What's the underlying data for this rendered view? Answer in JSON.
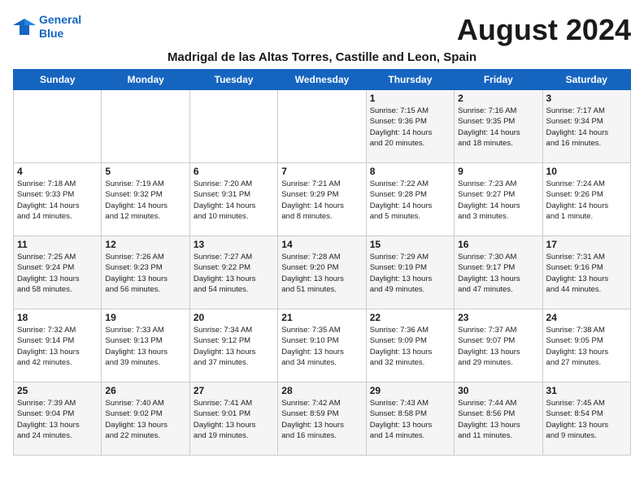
{
  "logo": {
    "line1": "General",
    "line2": "Blue"
  },
  "title": "August 2024",
  "subtitle": "Madrigal de las Altas Torres, Castille and Leon, Spain",
  "days_of_week": [
    "Sunday",
    "Monday",
    "Tuesday",
    "Wednesday",
    "Thursday",
    "Friday",
    "Saturday"
  ],
  "weeks": [
    [
      {
        "day": "",
        "info": ""
      },
      {
        "day": "",
        "info": ""
      },
      {
        "day": "",
        "info": ""
      },
      {
        "day": "",
        "info": ""
      },
      {
        "day": "1",
        "info": "Sunrise: 7:15 AM\nSunset: 9:36 PM\nDaylight: 14 hours\nand 20 minutes."
      },
      {
        "day": "2",
        "info": "Sunrise: 7:16 AM\nSunset: 9:35 PM\nDaylight: 14 hours\nand 18 minutes."
      },
      {
        "day": "3",
        "info": "Sunrise: 7:17 AM\nSunset: 9:34 PM\nDaylight: 14 hours\nand 16 minutes."
      }
    ],
    [
      {
        "day": "4",
        "info": "Sunrise: 7:18 AM\nSunset: 9:33 PM\nDaylight: 14 hours\nand 14 minutes."
      },
      {
        "day": "5",
        "info": "Sunrise: 7:19 AM\nSunset: 9:32 PM\nDaylight: 14 hours\nand 12 minutes."
      },
      {
        "day": "6",
        "info": "Sunrise: 7:20 AM\nSunset: 9:31 PM\nDaylight: 14 hours\nand 10 minutes."
      },
      {
        "day": "7",
        "info": "Sunrise: 7:21 AM\nSunset: 9:29 PM\nDaylight: 14 hours\nand 8 minutes."
      },
      {
        "day": "8",
        "info": "Sunrise: 7:22 AM\nSunset: 9:28 PM\nDaylight: 14 hours\nand 5 minutes."
      },
      {
        "day": "9",
        "info": "Sunrise: 7:23 AM\nSunset: 9:27 PM\nDaylight: 14 hours\nand 3 minutes."
      },
      {
        "day": "10",
        "info": "Sunrise: 7:24 AM\nSunset: 9:26 PM\nDaylight: 14 hours\nand 1 minute."
      }
    ],
    [
      {
        "day": "11",
        "info": "Sunrise: 7:25 AM\nSunset: 9:24 PM\nDaylight: 13 hours\nand 58 minutes."
      },
      {
        "day": "12",
        "info": "Sunrise: 7:26 AM\nSunset: 9:23 PM\nDaylight: 13 hours\nand 56 minutes."
      },
      {
        "day": "13",
        "info": "Sunrise: 7:27 AM\nSunset: 9:22 PM\nDaylight: 13 hours\nand 54 minutes."
      },
      {
        "day": "14",
        "info": "Sunrise: 7:28 AM\nSunset: 9:20 PM\nDaylight: 13 hours\nand 51 minutes."
      },
      {
        "day": "15",
        "info": "Sunrise: 7:29 AM\nSunset: 9:19 PM\nDaylight: 13 hours\nand 49 minutes."
      },
      {
        "day": "16",
        "info": "Sunrise: 7:30 AM\nSunset: 9:17 PM\nDaylight: 13 hours\nand 47 minutes."
      },
      {
        "day": "17",
        "info": "Sunrise: 7:31 AM\nSunset: 9:16 PM\nDaylight: 13 hours\nand 44 minutes."
      }
    ],
    [
      {
        "day": "18",
        "info": "Sunrise: 7:32 AM\nSunset: 9:14 PM\nDaylight: 13 hours\nand 42 minutes."
      },
      {
        "day": "19",
        "info": "Sunrise: 7:33 AM\nSunset: 9:13 PM\nDaylight: 13 hours\nand 39 minutes."
      },
      {
        "day": "20",
        "info": "Sunrise: 7:34 AM\nSunset: 9:12 PM\nDaylight: 13 hours\nand 37 minutes."
      },
      {
        "day": "21",
        "info": "Sunrise: 7:35 AM\nSunset: 9:10 PM\nDaylight: 13 hours\nand 34 minutes."
      },
      {
        "day": "22",
        "info": "Sunrise: 7:36 AM\nSunset: 9:09 PM\nDaylight: 13 hours\nand 32 minutes."
      },
      {
        "day": "23",
        "info": "Sunrise: 7:37 AM\nSunset: 9:07 PM\nDaylight: 13 hours\nand 29 minutes."
      },
      {
        "day": "24",
        "info": "Sunrise: 7:38 AM\nSunset: 9:05 PM\nDaylight: 13 hours\nand 27 minutes."
      }
    ],
    [
      {
        "day": "25",
        "info": "Sunrise: 7:39 AM\nSunset: 9:04 PM\nDaylight: 13 hours\nand 24 minutes."
      },
      {
        "day": "26",
        "info": "Sunrise: 7:40 AM\nSunset: 9:02 PM\nDaylight: 13 hours\nand 22 minutes."
      },
      {
        "day": "27",
        "info": "Sunrise: 7:41 AM\nSunset: 9:01 PM\nDaylight: 13 hours\nand 19 minutes."
      },
      {
        "day": "28",
        "info": "Sunrise: 7:42 AM\nSunset: 8:59 PM\nDaylight: 13 hours\nand 16 minutes."
      },
      {
        "day": "29",
        "info": "Sunrise: 7:43 AM\nSunset: 8:58 PM\nDaylight: 13 hours\nand 14 minutes."
      },
      {
        "day": "30",
        "info": "Sunrise: 7:44 AM\nSunset: 8:56 PM\nDaylight: 13 hours\nand 11 minutes."
      },
      {
        "day": "31",
        "info": "Sunrise: 7:45 AM\nSunset: 8:54 PM\nDaylight: 13 hours\nand 9 minutes."
      }
    ]
  ]
}
